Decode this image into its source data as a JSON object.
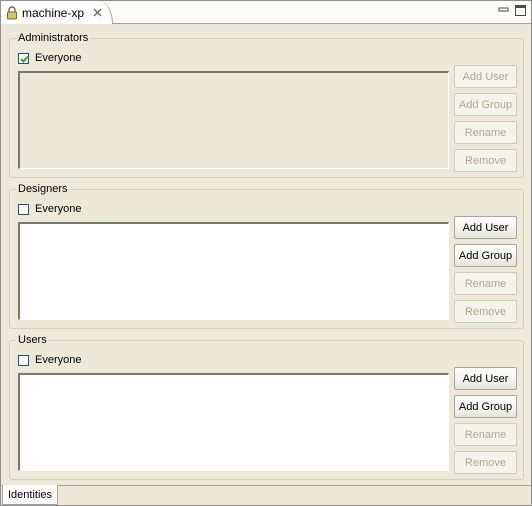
{
  "editor": {
    "tab_title": "machine-xp",
    "tab_icon": "lock-icon",
    "bottom_tabs": [
      {
        "label": "Identities",
        "active": true
      }
    ]
  },
  "groups": [
    {
      "legend": "Administrators",
      "everyone_label": "Everyone",
      "everyone_checked": true,
      "list_enabled": false,
      "buttons": [
        {
          "label": "Add User",
          "enabled": false
        },
        {
          "label": "Add Group",
          "enabled": false
        },
        {
          "label": "Rename",
          "enabled": false
        },
        {
          "label": "Remove",
          "enabled": false
        }
      ]
    },
    {
      "legend": "Designers",
      "everyone_label": "Everyone",
      "everyone_checked": false,
      "list_enabled": true,
      "buttons": [
        {
          "label": "Add User",
          "enabled": true
        },
        {
          "label": "Add Group",
          "enabled": true
        },
        {
          "label": "Rename",
          "enabled": false
        },
        {
          "label": "Remove",
          "enabled": false
        }
      ]
    },
    {
      "legend": "Users",
      "everyone_label": "Everyone",
      "everyone_checked": false,
      "list_enabled": true,
      "buttons": [
        {
          "label": "Add User",
          "enabled": true
        },
        {
          "label": "Add Group",
          "enabled": true
        },
        {
          "label": "Rename",
          "enabled": false
        },
        {
          "label": "Remove",
          "enabled": false
        }
      ]
    }
  ]
}
